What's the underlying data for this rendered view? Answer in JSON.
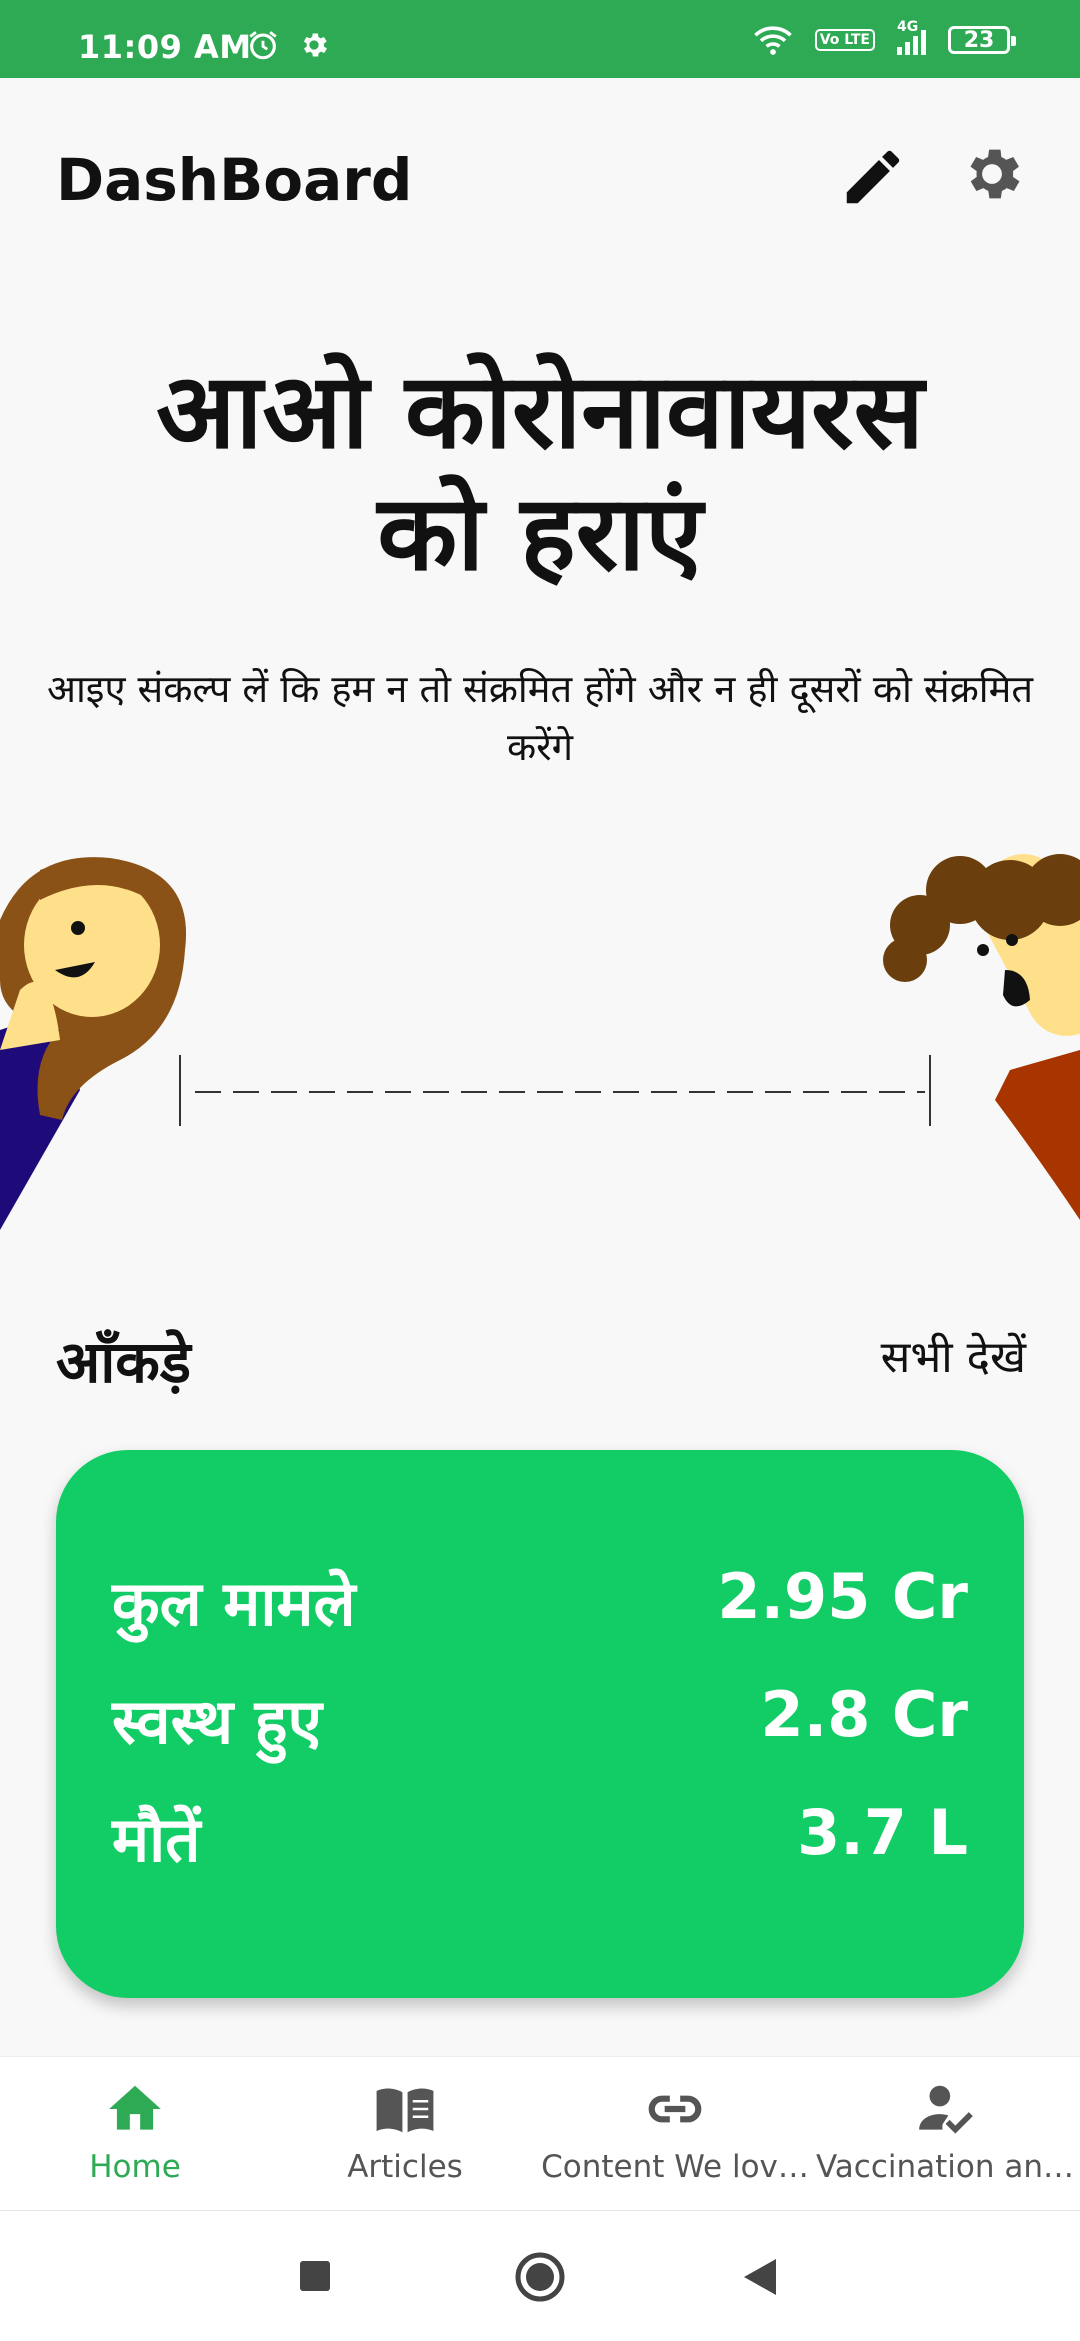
{
  "status": {
    "time": "11:09 AM",
    "network": "4G",
    "volte": "Vo LTE",
    "battery": "23"
  },
  "header": {
    "title": "DashBoard"
  },
  "hero": {
    "line1": "आओ कोरोनावायरस",
    "line2": "को हराएं",
    "subtitle": "आइए संकल्प लें कि हम न तो संक्रमित होंगे और न ही दूसरों को संक्रमित करेंगे"
  },
  "stats": {
    "section_title": "आँकड़े",
    "see_all": "सभी देखें",
    "rows": [
      {
        "label": "कुल मामले",
        "value": "2.95 Cr"
      },
      {
        "label": "स्वस्थ हुए",
        "value": "2.8 Cr"
      },
      {
        "label": "मौतें",
        "value": "3.7 L"
      }
    ]
  },
  "nav": {
    "items": [
      {
        "label": "Home",
        "icon": "home-icon"
      },
      {
        "label": "Articles",
        "icon": "book-icon"
      },
      {
        "label": "Content We lov…",
        "icon": "link-icon"
      },
      {
        "label": "Vaccination an…",
        "icon": "person-check-icon"
      }
    ],
    "active_color": "#2eaa55"
  },
  "colors": {
    "statusbar": "#2eaa55",
    "card": "#12cd66"
  }
}
